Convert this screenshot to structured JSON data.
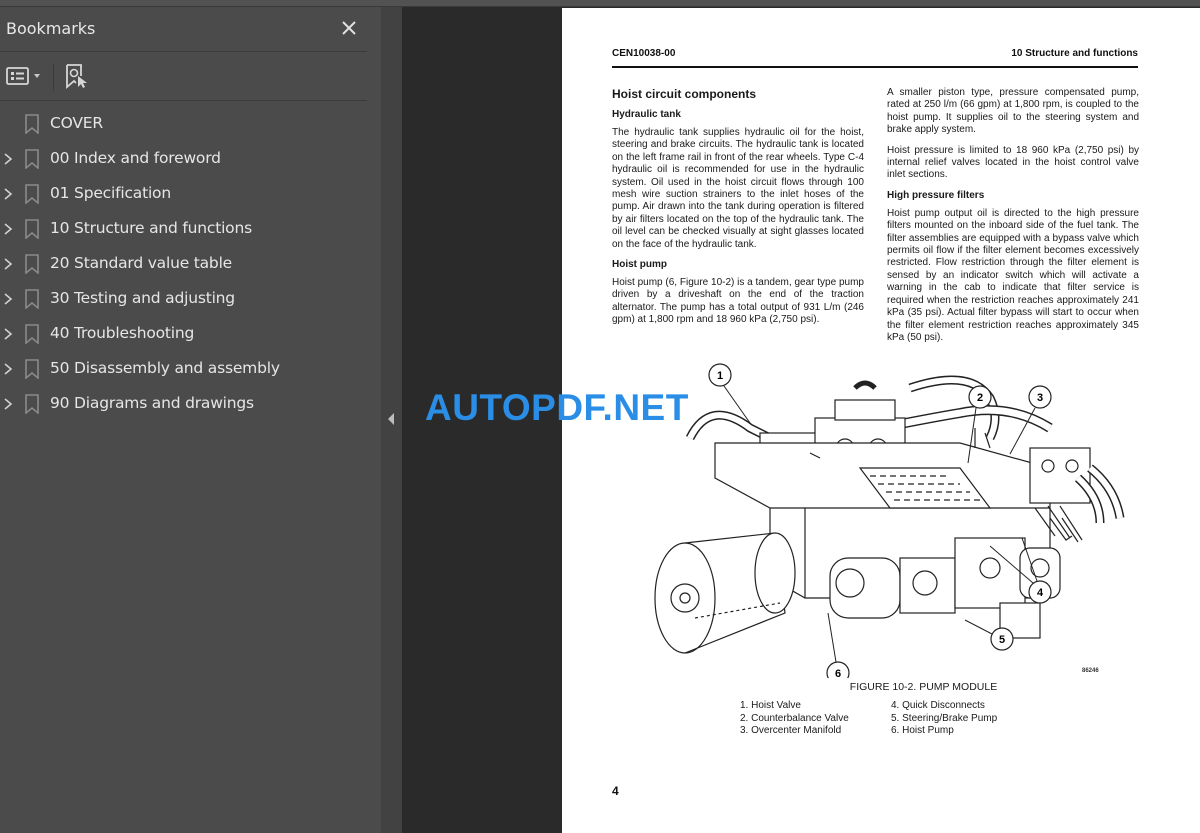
{
  "sidebar": {
    "title": "Bookmarks",
    "close_icon": "close-icon",
    "toolbar": {
      "options_icon": "list-options-icon",
      "find_icon": "find-bookmark-icon"
    },
    "items": [
      {
        "label": "COVER",
        "expandable": false
      },
      {
        "label": "00 Index and foreword",
        "expandable": true
      },
      {
        "label": "01 Specification",
        "expandable": true
      },
      {
        "label": "10 Structure and functions",
        "expandable": true
      },
      {
        "label": "20 Standard value table",
        "expandable": true
      },
      {
        "label": "30 Testing and adjusting",
        "expandable": true
      },
      {
        "label": "40 Troubleshooting",
        "expandable": true
      },
      {
        "label": "50 Disassembly and assembly",
        "expandable": true
      },
      {
        "label": "90 Diagrams and drawings",
        "expandable": true
      }
    ]
  },
  "watermark": "AUTOPDF.NET",
  "page": {
    "header_left": "CEN10038-00",
    "header_right": "10 Structure and functions",
    "section_title": "Hoist circuit components",
    "left_column": [
      {
        "heading": "Hydraulic tank",
        "text": "The hydraulic tank supplies hydraulic oil for the hoist, steering and brake circuits. The hydraulic tank is located on the left frame rail in front of the rear wheels. Type C-4 hydraulic oil is recommended for use in the hydraulic system. Oil used in the hoist circuit flows through 100 mesh wire suction strainers to the inlet hoses of the pump. Air drawn into the tank during operation is filtered by air filters located on the top of the hydraulic tank. The oil level can be checked visually at sight glasses located on the face of the hydraulic tank."
      },
      {
        "heading": "Hoist pump",
        "text": "Hoist pump (6, Figure 10-2) is a tandem, gear type pump driven by a driveshaft on the end of the traction alternator. The pump has a total output of 931 L/m (246 gpm) at 1,800 rpm and 18 960 kPa (2,750 psi)."
      }
    ],
    "right_column": {
      "para1": "A smaller piston type, pressure compensated pump, rated at 250 l/m (66 gpm) at 1,800 rpm, is coupled to the hoist pump. It supplies oil to the steering system and brake apply system.",
      "para2": "Hoist pressure is limited to 18 960 kPa (2,750 psi) by internal relief valves located in the hoist control valve inlet sections.",
      "heading": "High pressure filters",
      "para3": "Hoist pump output oil is directed to the high pressure filters mounted on the inboard side of the fuel tank. The filter assemblies are equipped with a bypass valve which permits oil flow if the filter element becomes excessively restricted. Flow restriction through the filter element is sensed by an indicator switch which will activate a warning in the cab to indicate that filter service is required when the restriction reaches approximately 241 kPa (35 psi). Actual filter bypass will start to occur when the filter element restriction reaches approximately 345 kPa (50 psi)."
    },
    "figure": {
      "callouts": [
        "1",
        "2",
        "3",
        "4",
        "5",
        "6"
      ],
      "code": "86246",
      "caption": "FIGURE 10-2. PUMP MODULE",
      "legend_col1": [
        "1. Hoist Valve",
        "2. Counterbalance Valve",
        "3. Overcenter Manifold"
      ],
      "legend_col2": [
        "4. Quick Disconnects",
        "5. Steering/Brake Pump",
        "6. Hoist Pump"
      ]
    },
    "page_number": "4"
  }
}
